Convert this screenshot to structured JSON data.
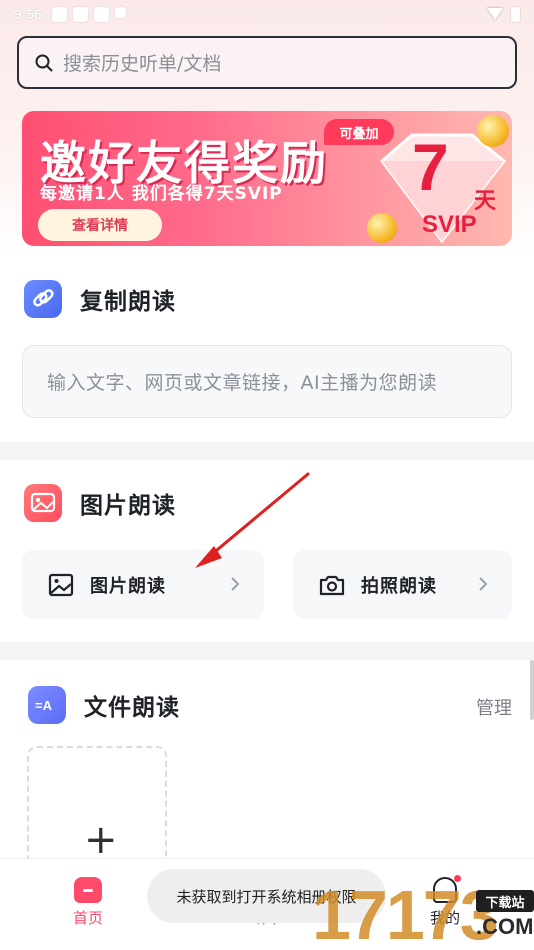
{
  "status_bar": {
    "time": "9:56"
  },
  "search": {
    "placeholder": "搜索历史听单/文档"
  },
  "banner": {
    "title": "邀好友得奖励",
    "subtitle": "每邀请1人 我们各得7天SVIP",
    "button": "查看详情",
    "tag": "可叠加",
    "badge_number": "7",
    "badge_unit": "天",
    "badge_svip": "SVIP"
  },
  "copy_read": {
    "title": "复制朗读",
    "input_placeholder": "输入文字、网页或文章链接，AI主播为您朗读"
  },
  "image_read": {
    "title": "图片朗读",
    "buttons": [
      {
        "label": "图片朗读",
        "icon": "image-icon"
      },
      {
        "label": "拍照朗读",
        "icon": "camera-icon"
      }
    ]
  },
  "file_read": {
    "title": "文件朗读",
    "manage": "管理",
    "add_symbol": "+"
  },
  "bottom_nav": [
    {
      "label": "首页",
      "icon": "home-icon",
      "active": true
    },
    {
      "label": "听单",
      "icon": "playlist-icon",
      "active": false
    },
    {
      "label": "我的",
      "icon": "profile-icon",
      "active": false
    }
  ],
  "toast": "未获取到打开系统相册权限",
  "watermark": {
    "number": "17173",
    "tag": "下载站",
    "domain": ".COM"
  },
  "colors": {
    "accent": "#ff4a6a",
    "arrow": "#e02020"
  }
}
